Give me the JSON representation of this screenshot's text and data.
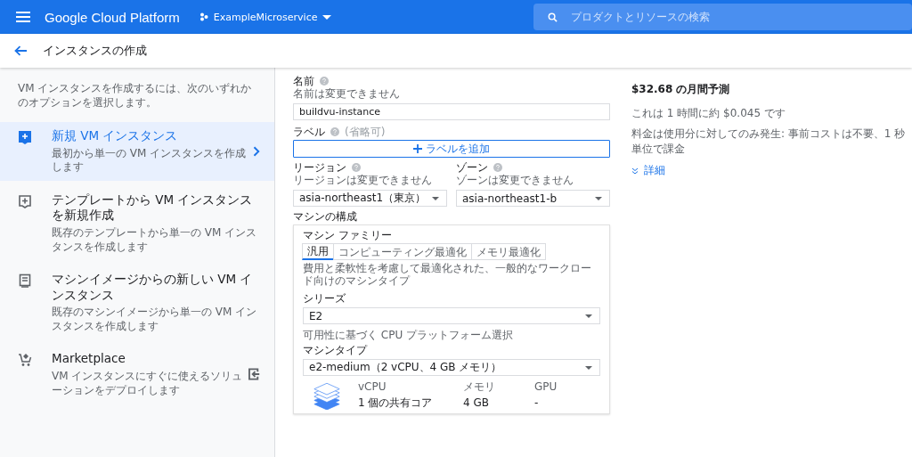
{
  "topbar": {
    "product": "Google Cloud Platform",
    "project": "ExampleMicroservice",
    "search": {
      "placeholder": "プロダクトとリソースの検索"
    }
  },
  "page_title": "インスタンスの作成",
  "sidebar": {
    "intro": "VM インスタンスを作成するには、次のいずれかのオプションを選択します。",
    "items": [
      {
        "kind": "new",
        "title": "新規 VM インスタンス",
        "description": "最初から単一の VM インスタンスを作成します",
        "selected": true
      },
      {
        "kind": "template",
        "title": "テンプレートから VM インスタンスを新規作成",
        "description": "既存のテンプレートから単一の VM インスタンスを作成します",
        "selected": false
      },
      {
        "kind": "image",
        "title": "マシンイメージからの新しい VM インスタンス",
        "description": "既存のマシンイメージから単一の VM インスタンスを作成します",
        "selected": false
      },
      {
        "kind": "marketplace",
        "title": "Marketplace",
        "description": "VM インスタンスにすぐに使えるソリューションをデプロイします",
        "selected": false
      }
    ]
  },
  "form": {
    "name": {
      "label": "名前",
      "hint": "名前は変更できません",
      "value": "buildvu-instance"
    },
    "labels": {
      "label": "ラベル",
      "optional": "(省略可)",
      "button": "ラベルを追加"
    },
    "region": {
      "label": "リージョン",
      "hint": "リージョンは変更できません",
      "value": "asia-northeast1（東京）"
    },
    "zone": {
      "label": "ゾーン",
      "hint": "ゾーンは変更できません",
      "value": "asia-northeast1-b"
    },
    "machine": {
      "title": "マシンの構成",
      "family_label": "マシン ファミリー",
      "tabs": [
        {
          "label": "汎用",
          "selected": true
        },
        {
          "label": "コンピューティング最適化",
          "selected": false
        },
        {
          "label": "メモリ最適化",
          "selected": false
        }
      ],
      "family_description": "費用と柔軟性を考慮して最適化された、一般的なワークロード向けのマシンタイプ",
      "series": {
        "label": "シリーズ",
        "value": "E2",
        "hint": "可用性に基づく CPU プラットフォーム選択"
      },
      "type": {
        "label": "マシンタイプ",
        "value": "e2-medium（2 vCPU、4 GB メモリ）"
      },
      "specs": {
        "columns": [
          "vCPU",
          "メモリ",
          "GPU"
        ],
        "values": [
          "1 個の共有コア",
          "4 GB",
          "-"
        ]
      }
    }
  },
  "pricing": {
    "title": "$32.68 の月間予測",
    "hourly": "これは 1 時間に約 $0.045 です",
    "note": "料金は使用分に対してのみ発生: 事前コストは不要、1 秒単位で課金",
    "details": "詳細"
  }
}
